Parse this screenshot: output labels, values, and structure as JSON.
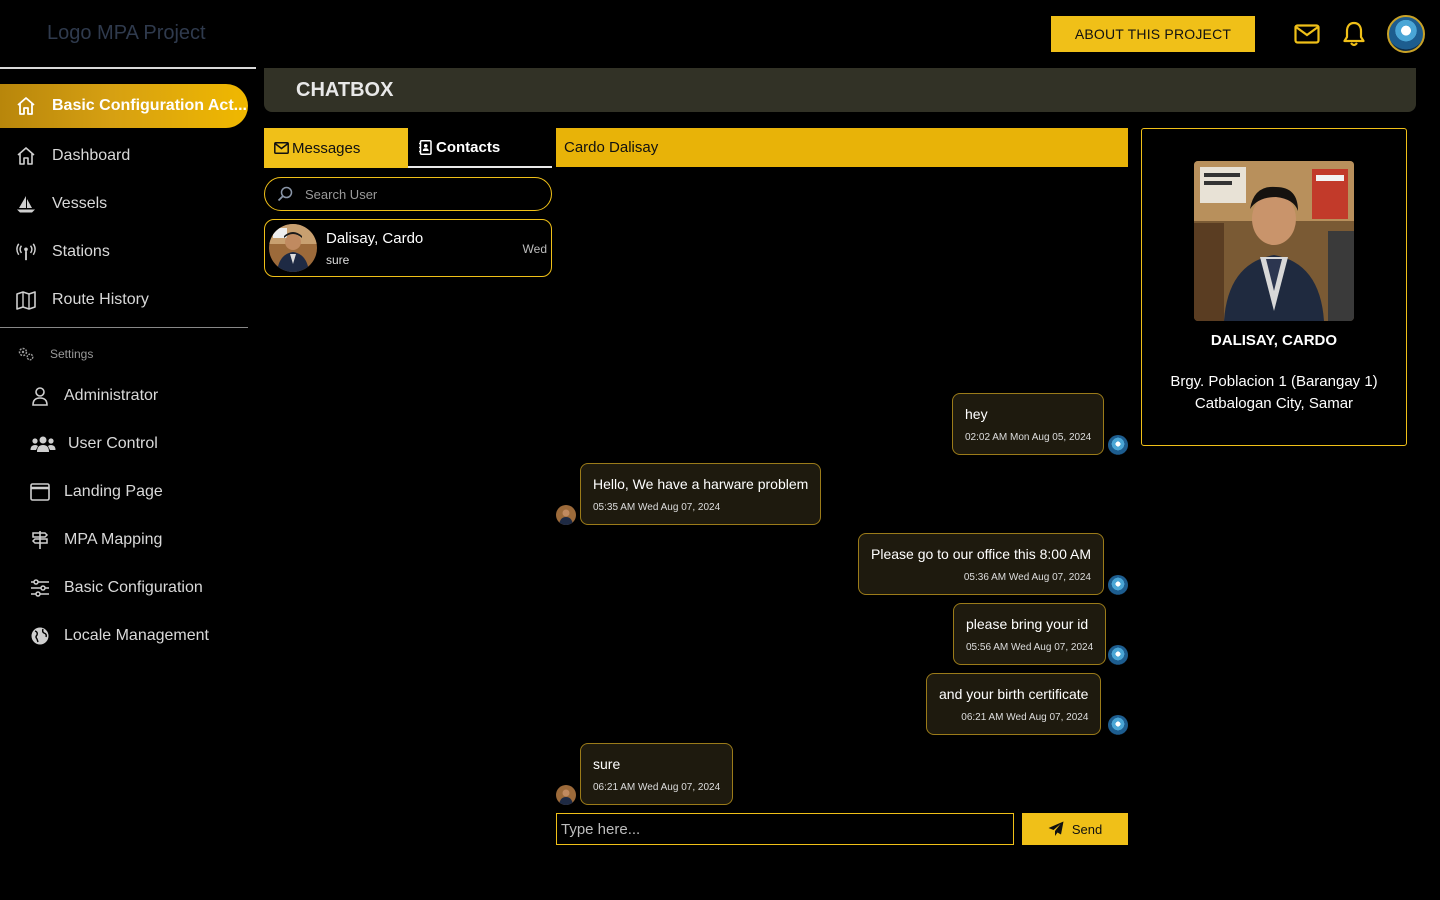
{
  "app": {
    "logo_text": "Logo MPA Project"
  },
  "topbar": {
    "about_label": "ABOUT THIS PROJECT",
    "icons": [
      "mail-icon",
      "bell-icon"
    ],
    "accent": "#f0c018"
  },
  "sidebar": {
    "active": {
      "label": "Basic Configuration Act...",
      "icon": "home-icon"
    },
    "items": [
      {
        "label": "Dashboard",
        "icon": "home-icon"
      },
      {
        "label": "Vessels",
        "icon": "sailboat-icon"
      },
      {
        "label": "Stations",
        "icon": "antenna-icon"
      },
      {
        "label": "Route History",
        "icon": "map-icon"
      }
    ],
    "settings_label": "Settings",
    "settings_items": [
      {
        "label": "Administrator",
        "icon": "user-icon"
      },
      {
        "label": "User Control",
        "icon": "users-icon"
      },
      {
        "label": "Landing Page",
        "icon": "window-icon"
      },
      {
        "label": "MPA Mapping",
        "icon": "signpost-icon"
      },
      {
        "label": "Basic Configuration",
        "icon": "sliders-icon"
      },
      {
        "label": "Locale Management",
        "icon": "globe-icon"
      }
    ]
  },
  "page": {
    "title": "CHATBOX"
  },
  "tabs": {
    "messages": "Messages",
    "contacts": "Contacts"
  },
  "search": {
    "placeholder": "Search User"
  },
  "contacts": [
    {
      "name": "Dalisay, Cardo",
      "last_message": "sure",
      "time": "Wed"
    }
  ],
  "chat": {
    "header": "Cardo Dalisay",
    "messages": [
      {
        "from": "me",
        "text": "hey",
        "time": "02:02 AM Mon Aug 05, 2024"
      },
      {
        "from": "them",
        "text": "Hello, We have a harware problem",
        "time": "05:35 AM Wed Aug 07, 2024"
      },
      {
        "from": "me",
        "text": "Please go to our office this 8:00 AM",
        "time": "05:36 AM Wed Aug 07, 2024"
      },
      {
        "from": "me",
        "text": "please bring your id",
        "time": "05:56 AM Wed Aug 07, 2024"
      },
      {
        "from": "me",
        "text": "and your birth certificate",
        "time": "06:21 AM Wed Aug 07, 2024"
      },
      {
        "from": "them",
        "text": "sure",
        "time": "06:21 AM Wed Aug 07, 2024"
      }
    ],
    "input_placeholder": "Type here...",
    "send_label": "Send"
  },
  "profile": {
    "name": "DALISAY, CARDO",
    "address_line1": "Brgy. Poblacion 1 (Barangay 1)",
    "address_line2": "Catbalogan City, Samar"
  }
}
